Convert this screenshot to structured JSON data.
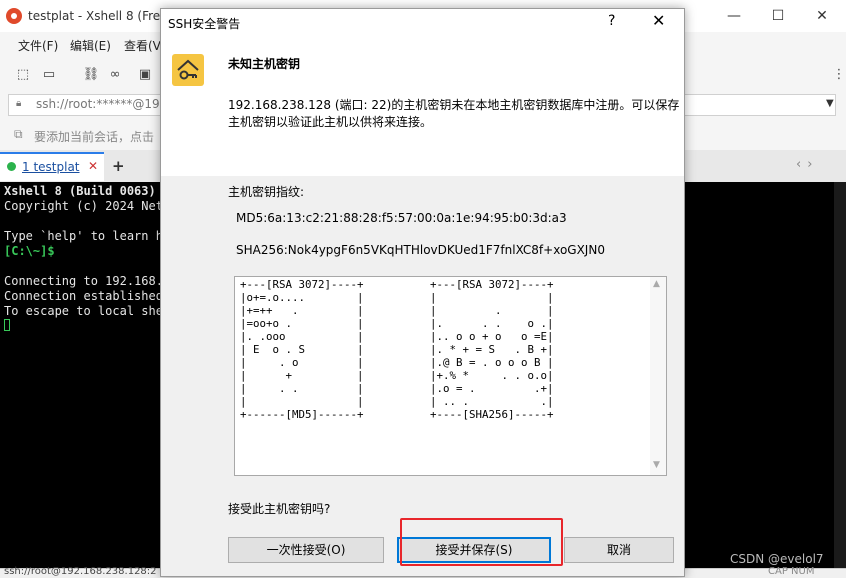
{
  "app": {
    "title": "testplat - Xshell 8 (Free",
    "menu": [
      "文件(F)",
      "编辑(E)",
      "查看(V"
    ],
    "address": "ssh://root:******@192",
    "hint": "要添加当前会话，点击",
    "tab_label": "1 testplat",
    "tab_close": "✕",
    "tab_add": "+",
    "tab_nav": "‹›",
    "status": "ssh://root@192.168.238.128:2",
    "status_right": "CAP NUM",
    "watermark": "CSDN @evelol7"
  },
  "terminal": {
    "lines": [
      "Xshell 8 (Build 0063)",
      "Copyright (c) 2024 Net",
      "",
      "Type `help' to learn ho",
      "[C:\\~]$",
      "",
      "Connecting to 192.168.2",
      "Connection established",
      "To escape to local shel"
    ]
  },
  "dialog": {
    "title": "SSH安全警告",
    "help": "?",
    "close": "✕",
    "heading": "未知主机密钥",
    "description_line1": "192.168.238.128 (端口: 22)的主机密钥未在本地主机密钥数据库中注册。可以保存",
    "description_line2": "主机密钥以验证此主机以供将来连接。",
    "fingerprint_label": "主机密钥指纹:",
    "md5": "MD5:6a:13:c2:21:88:28:f5:57:00:0a:1e:94:95:b0:3d:a3",
    "sha256": "SHA256:Nok4ypgF6n5VKqHTHlovDKUed1F7fnlXC8f+xoGXJN0",
    "randomart_md5": "+---[RSA 3072]----+\n|o+=.o....        |\n|+=++   .         |\n|=oo+o .          |\n|. .ooo           |\n| E  o . S        |\n|     . o         |\n|      +          |\n|     . .         |\n|                 |\n+------[MD5]------+",
    "randomart_sha256": "+---[RSA 3072]----+\n|                 |\n|         .       |\n|.      . .    o .|\n|.. o o + o   o =E|\n|. * + = S   . B +|\n|.@ B = . o o o B |\n|+.% *     . . o.o|\n|.o = .         .+|\n| .. .           .|\n+----[SHA256]-----+",
    "question": "接受此主机密钥吗?",
    "buttons": {
      "accept_once": "一次性接受(O)",
      "accept_save": "接受并保存(S)",
      "cancel": "取消"
    }
  },
  "colors": {
    "highlight": "#e8262b",
    "focus": "#0078d7",
    "key_icon": "#f5c542"
  }
}
